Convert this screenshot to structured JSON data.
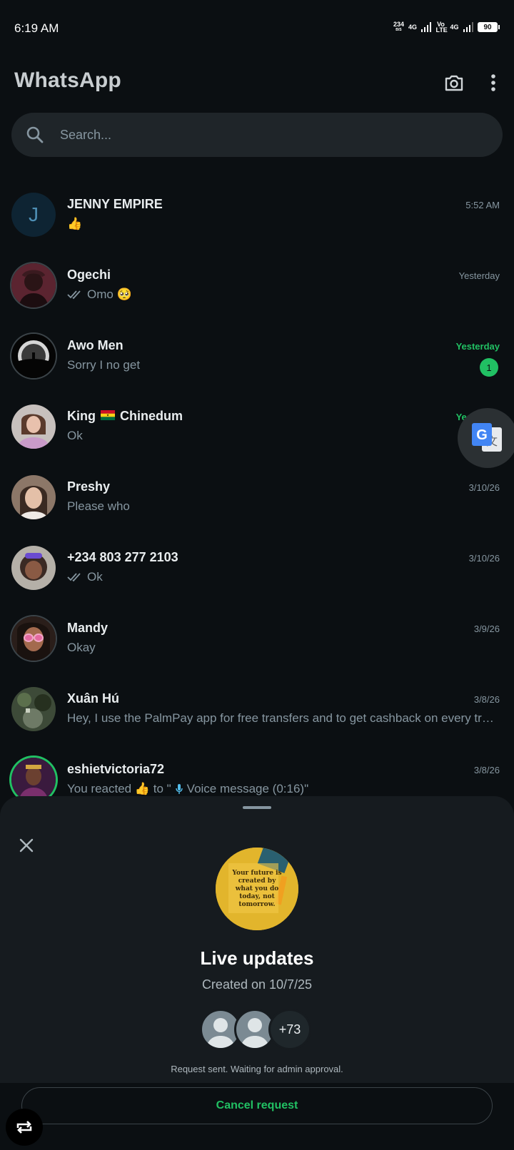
{
  "status_bar": {
    "time": "6:19 AM",
    "net_speed": "234",
    "net_unit": "B/S",
    "network1": "4G",
    "volte": "Vo LTE",
    "network2": "4G",
    "battery": "90"
  },
  "header": {
    "title": "WhatsApp"
  },
  "search": {
    "placeholder": "Search..."
  },
  "chats": [
    {
      "name": "JENNY EMPIRE",
      "time": "5:52 AM",
      "preview": "👍",
      "avatar_letter": "J"
    },
    {
      "name": "Ogechi",
      "time": "Yesterday",
      "preview": "Omo 🥺",
      "read_receipt": true
    },
    {
      "name": "Awo Men",
      "time": "Yesterday",
      "preview": "Sorry I no get",
      "unread": "1"
    },
    {
      "name_prefix": "King",
      "name_suffix": "Chinedum",
      "time": "Yesterday",
      "preview": "Ok"
    },
    {
      "name": "Preshy",
      "time": "3/10/26",
      "preview": "Please who"
    },
    {
      "name": "+234 803 277 2103",
      "time": "3/10/26",
      "preview": "Ok",
      "read_receipt": true
    },
    {
      "name": "Mandy",
      "time": "3/9/26",
      "preview": "Okay"
    },
    {
      "name": "Xuân Hú",
      "time": "3/8/26",
      "preview": "Hey, I use the PalmPay app for free transfers and to get cashback on every transact..."
    },
    {
      "name": "eshietvictoria72",
      "time": "3/8/26",
      "preview_a": "You reacted 👍 to \"",
      "preview_b": "Voice message (0:16)\""
    }
  ],
  "sheet": {
    "image_text": "Your future is created by what you do today, not tomorrow.",
    "title": "Live updates",
    "subtitle": "Created on 10/7/25",
    "member_count": "+73",
    "status": "Request sent. Waiting for admin approval.",
    "cancel_label": "Cancel request"
  },
  "colors": {
    "background": "#0b0f12",
    "accent_green": "#21c063",
    "secondary_text": "#8696a0"
  }
}
